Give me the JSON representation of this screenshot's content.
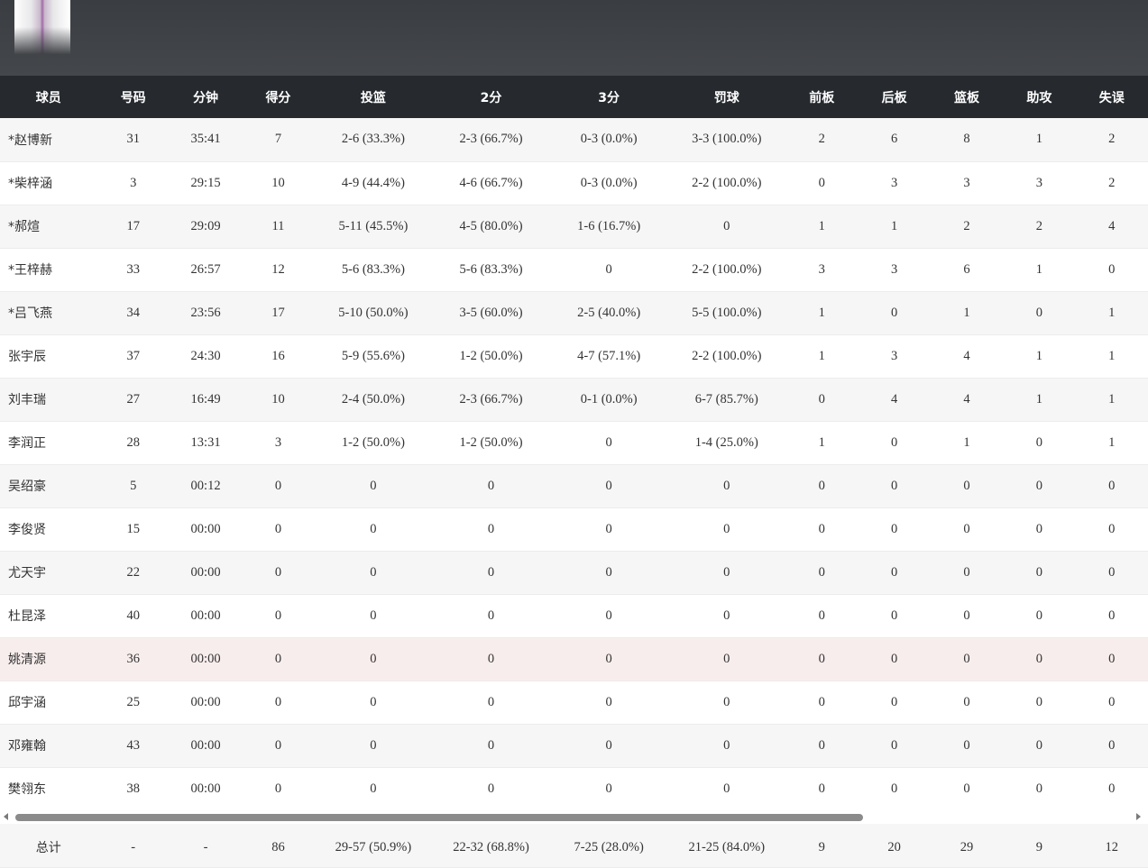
{
  "team": {
    "logo": "team-logo"
  },
  "headers": [
    "球员",
    "号码",
    "分钟",
    "得分",
    "投篮",
    "2分",
    "3分",
    "罚球",
    "前板",
    "后板",
    "篮板",
    "助攻",
    "失误"
  ],
  "players": [
    [
      "*赵博新",
      "31",
      "35:41",
      "7",
      "2-6 (33.3%)",
      "2-3 (66.7%)",
      "0-3 (0.0%)",
      "3-3 (100.0%)",
      "2",
      "6",
      "8",
      "1",
      "2"
    ],
    [
      "*柴梓涵",
      "3",
      "29:15",
      "10",
      "4-9 (44.4%)",
      "4-6 (66.7%)",
      "0-3 (0.0%)",
      "2-2 (100.0%)",
      "0",
      "3",
      "3",
      "3",
      "2"
    ],
    [
      "*郝煊",
      "17",
      "29:09",
      "11",
      "5-11 (45.5%)",
      "4-5 (80.0%)",
      "1-6 (16.7%)",
      "0",
      "1",
      "1",
      "2",
      "2",
      "4"
    ],
    [
      "*王梓赫",
      "33",
      "26:57",
      "12",
      "5-6 (83.3%)",
      "5-6 (83.3%)",
      "0",
      "2-2 (100.0%)",
      "3",
      "3",
      "6",
      "1",
      "0"
    ],
    [
      "*吕飞燕",
      "34",
      "23:56",
      "17",
      "5-10 (50.0%)",
      "3-5 (60.0%)",
      "2-5 (40.0%)",
      "5-5 (100.0%)",
      "1",
      "0",
      "1",
      "0",
      "1"
    ],
    [
      "张宇辰",
      "37",
      "24:30",
      "16",
      "5-9 (55.6%)",
      "1-2 (50.0%)",
      "4-7 (57.1%)",
      "2-2 (100.0%)",
      "1",
      "3",
      "4",
      "1",
      "1"
    ],
    [
      "刘丰瑞",
      "27",
      "16:49",
      "10",
      "2-4 (50.0%)",
      "2-3 (66.7%)",
      "0-1 (0.0%)",
      "6-7 (85.7%)",
      "0",
      "4",
      "4",
      "1",
      "1"
    ],
    [
      "李润正",
      "28",
      "13:31",
      "3",
      "1-2 (50.0%)",
      "1-2 (50.0%)",
      "0",
      "1-4 (25.0%)",
      "1",
      "0",
      "1",
      "0",
      "1"
    ],
    [
      "吴绍豪",
      "5",
      "00:12",
      "0",
      "0",
      "0",
      "0",
      "0",
      "0",
      "0",
      "0",
      "0",
      "0"
    ],
    [
      "李俊贤",
      "15",
      "00:00",
      "0",
      "0",
      "0",
      "0",
      "0",
      "0",
      "0",
      "0",
      "0",
      "0"
    ],
    [
      "尤天宇",
      "22",
      "00:00",
      "0",
      "0",
      "0",
      "0",
      "0",
      "0",
      "0",
      "0",
      "0",
      "0"
    ],
    [
      "杜昆泽",
      "40",
      "00:00",
      "0",
      "0",
      "0",
      "0",
      "0",
      "0",
      "0",
      "0",
      "0",
      "0"
    ],
    [
      "姚清源",
      "36",
      "00:00",
      "0",
      "0",
      "0",
      "0",
      "0",
      "0",
      "0",
      "0",
      "0",
      "0"
    ],
    [
      "邱宇涵",
      "25",
      "00:00",
      "0",
      "0",
      "0",
      "0",
      "0",
      "0",
      "0",
      "0",
      "0",
      "0"
    ],
    [
      "邓雍翰",
      "43",
      "00:00",
      "0",
      "0",
      "0",
      "0",
      "0",
      "0",
      "0",
      "0",
      "0",
      "0"
    ],
    [
      "樊翎东",
      "38",
      "00:00",
      "0",
      "0",
      "0",
      "0",
      "0",
      "0",
      "0",
      "0",
      "0",
      "0"
    ]
  ],
  "highlighted_row": "姚清源",
  "totals": [
    "总计",
    "-",
    "-",
    "86",
    "29-57 (50.9%)",
    "22-32 (68.8%)",
    "7-25 (28.0%)",
    "21-25 (84.0%)",
    "9",
    "20",
    "29",
    "9",
    "12"
  ],
  "colors": {
    "header_bg": "#262a2f",
    "banner_bg": "#44474b",
    "row_alt": "#f6f6f6",
    "row_highlight": "#f8eded"
  }
}
